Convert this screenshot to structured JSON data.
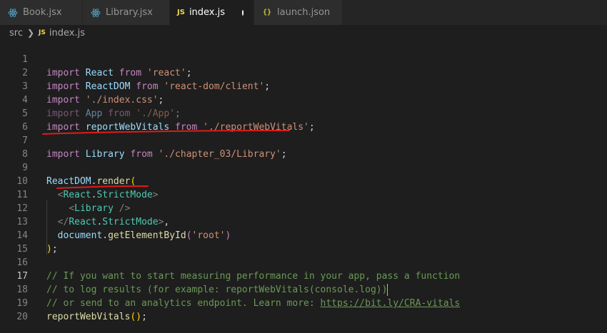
{
  "tabs": [
    {
      "label": "Book.jsx",
      "icon": "react-icon"
    },
    {
      "label": "Library.jsx",
      "icon": "react-icon"
    },
    {
      "label": "index.js",
      "icon": "js-icon",
      "icon_text": "JS",
      "active": true,
      "dirty": true
    },
    {
      "label": "launch.json",
      "icon": "json-icon",
      "icon_text": "{}"
    }
  ],
  "breadcrumb": {
    "folder": "src",
    "file_icon_text": "JS",
    "file": "index.js"
  },
  "editor": {
    "current_line": 17,
    "line_numbers": [
      "1",
      "2",
      "3",
      "4",
      "5",
      "6",
      "7",
      "8",
      "9",
      "10",
      "11",
      "12",
      "13",
      "14",
      "15",
      "16",
      "17",
      "18",
      "19",
      "20"
    ],
    "tokens": {
      "l1": [
        "import",
        "React",
        "from",
        "'react'",
        ";"
      ],
      "l2": [
        "import",
        "ReactDOM",
        "from",
        "'react-dom/client'",
        ";"
      ],
      "l3": [
        "import",
        "'./index.css'",
        ";"
      ],
      "l4": [
        "import",
        "App",
        "from",
        "'./App'",
        ";"
      ],
      "l5": [
        "import",
        "reportWebVitals",
        "from",
        "'./reportWebVitals'",
        ";"
      ],
      "l7": [
        "import",
        "Library",
        "from",
        "'./chapter_03/Library'",
        ";"
      ],
      "l9": [
        "ReactDOM",
        ".",
        "render",
        "("
      ],
      "l10": [
        "<",
        "React",
        ".",
        "StrictMode",
        ">"
      ],
      "l11": [
        "<",
        "Library",
        " />"
      ],
      "l12": [
        "</",
        "React",
        ".",
        "StrictMode",
        ">",
        ","
      ],
      "l13": [
        "document",
        ".",
        "getElementById",
        "(",
        "'root'",
        ")"
      ],
      "l14": [
        ")",
        ";"
      ],
      "l16": "// If you want to start measuring performance in your app, pass a function",
      "l17": "// to log results (for example: reportWebVitals(console.log))",
      "l18": [
        "// or send to an analytics endpoint. Learn more: ",
        "https://bit.ly/CRA-vitals"
      ],
      "l19": [
        "reportWebVitals",
        "(",
        ")",
        ";"
      ]
    }
  },
  "colors": {
    "annotation": "#e01b1b",
    "keyword": "#c586c0",
    "string": "#ce9178",
    "comment": "#6a9955",
    "variable": "#9cdcfe",
    "function": "#dcdcaa",
    "type": "#4ec9b0"
  }
}
